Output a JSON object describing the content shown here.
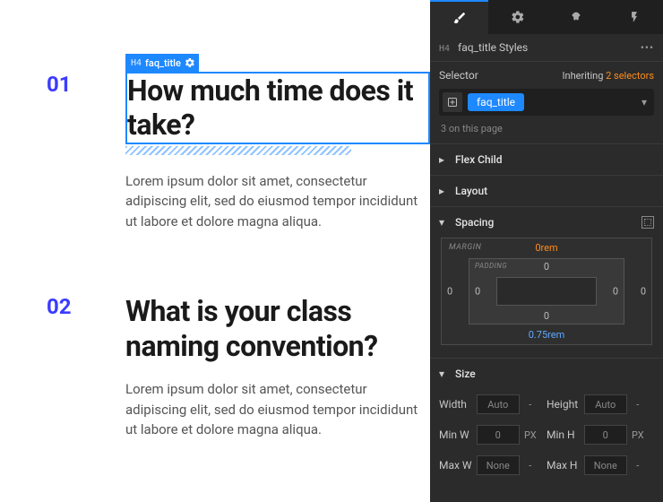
{
  "canvas": {
    "selected_tag_prefix": "H4",
    "selected_tag_label": "faq_title",
    "faqs": [
      {
        "num": "01",
        "title": "How much time does it take?",
        "text": "Lorem ipsum dolor sit amet, consectetur adipiscing elit, sed do eiusmod tempor incididunt ut labore et dolore magna aliqua."
      },
      {
        "num": "02",
        "title": "What is your class naming convention?",
        "text": "Lorem ipsum dolor sit amet, consectetur adipiscing elit, sed do eiusmod tempor incididunt ut labore et dolore magna aliqua."
      }
    ]
  },
  "panel": {
    "breadcrumb_prefix": "H4",
    "breadcrumb_label": "faq_title Styles",
    "selector_label": "Selector",
    "inheriting_label": "Inheriting",
    "inheriting_count": "2 selectors",
    "class_token": "faq_title",
    "on_page": "3 on this page",
    "sections": {
      "flex_child": "Flex Child",
      "layout": "Layout",
      "spacing": "Spacing",
      "size": "Size"
    },
    "spacing": {
      "margin_label": "MARGIN",
      "padding_label": "PADDING",
      "m_top": "0rem",
      "m_right": "0",
      "m_bottom": "0.75rem",
      "m_left": "0",
      "p_top": "0",
      "p_right": "0",
      "p_bottom": "0",
      "p_left": "0"
    },
    "size": {
      "width_label": "Width",
      "width_val": "Auto",
      "width_unit": "-",
      "height_label": "Height",
      "height_val": "Auto",
      "height_unit": "-",
      "minw_label": "Min W",
      "minw_val": "0",
      "minw_unit": "PX",
      "minh_label": "Min H",
      "minh_val": "0",
      "minh_unit": "PX",
      "maxw_label": "Max W",
      "maxw_val": "None",
      "maxw_unit": "-",
      "maxh_label": "Max H",
      "maxh_val": "None",
      "maxh_unit": "-"
    }
  }
}
